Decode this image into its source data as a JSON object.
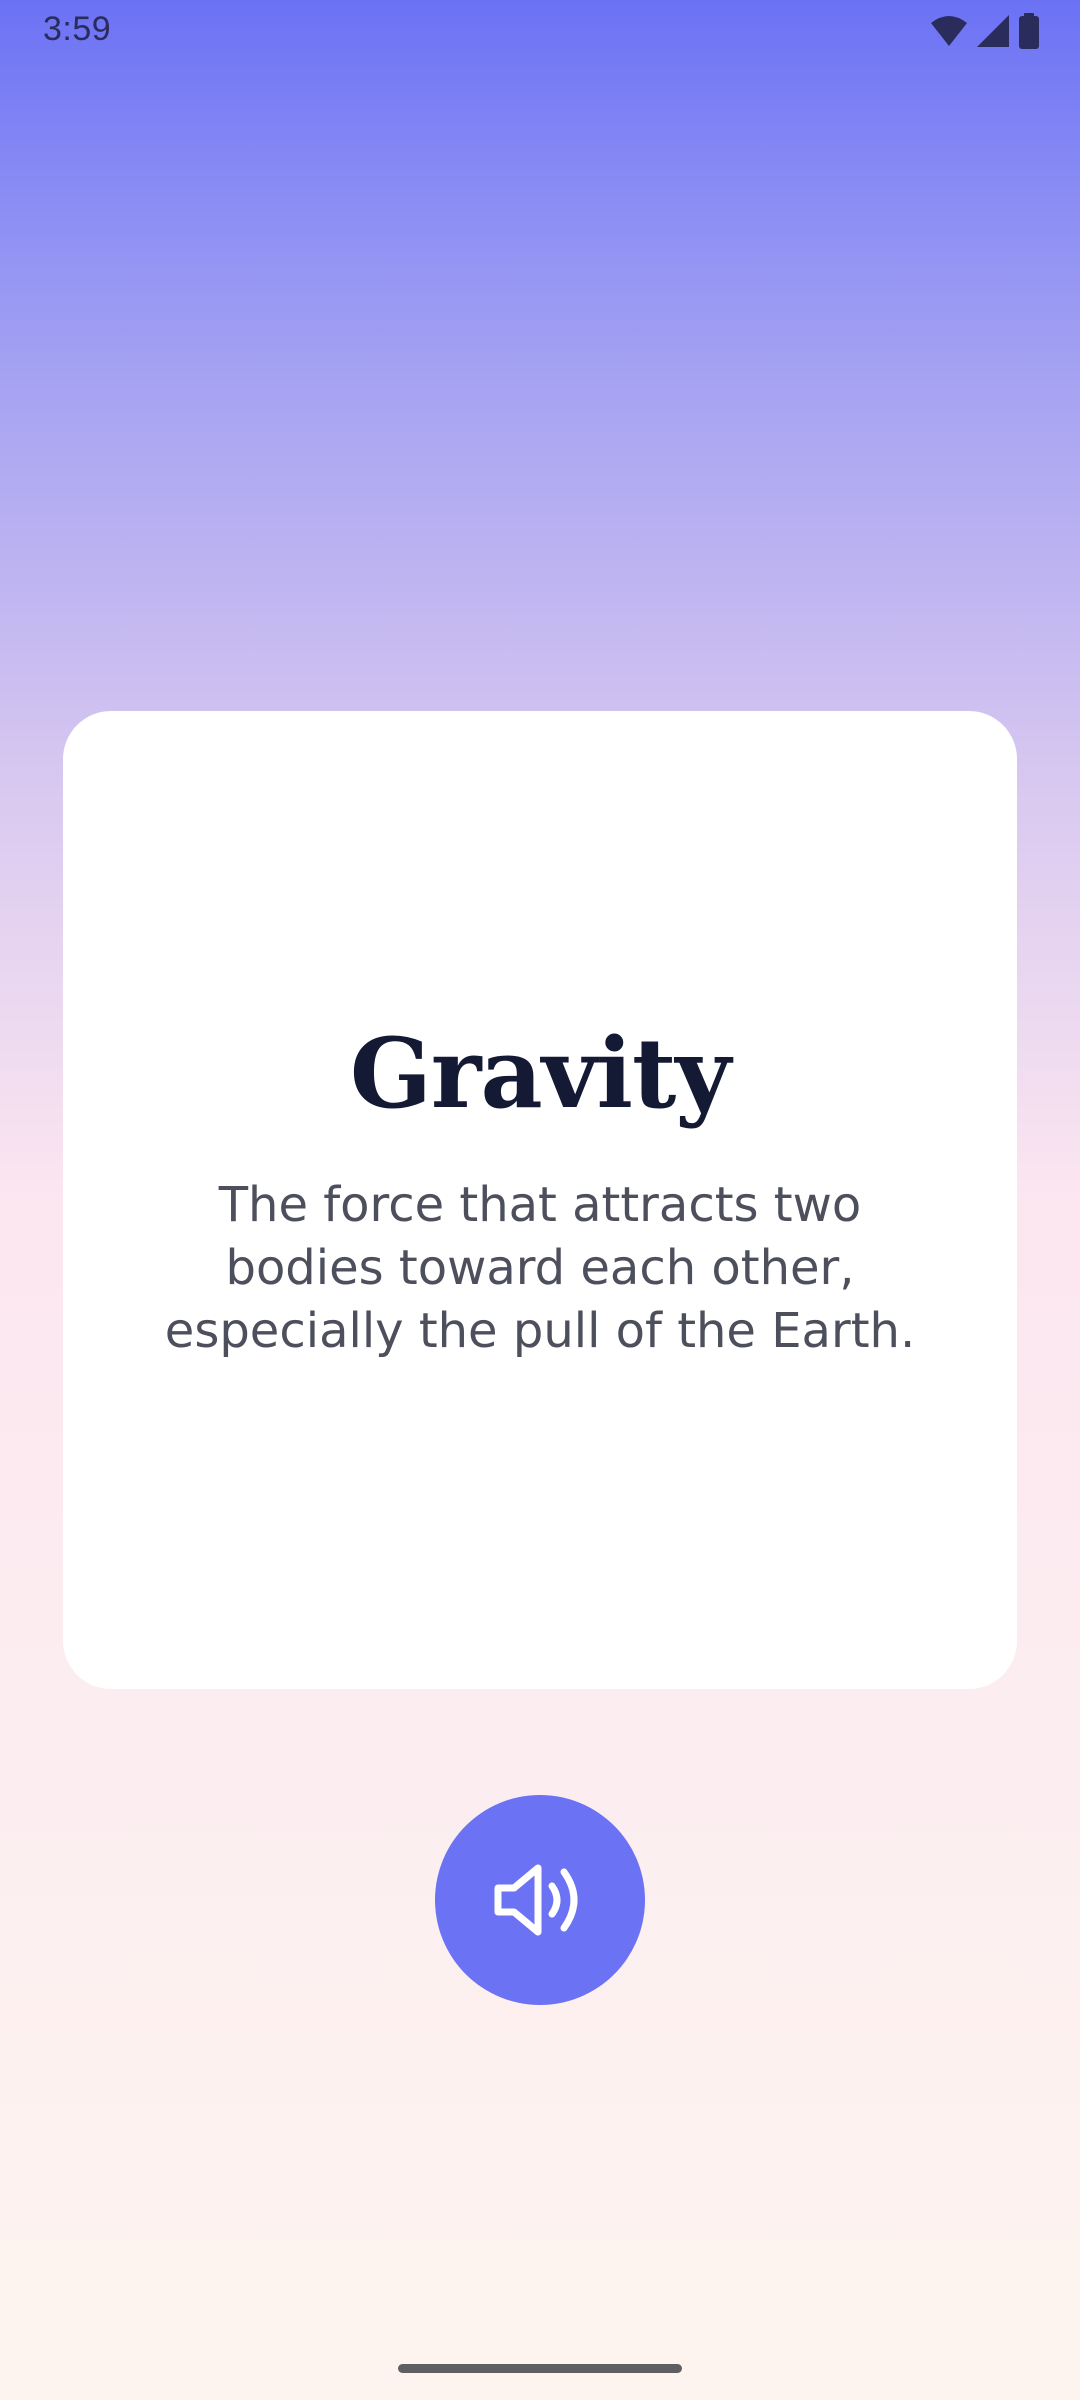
{
  "status_bar": {
    "time": "3:59",
    "icons": [
      "wifi-icon",
      "cellular-signal-icon",
      "battery-icon"
    ]
  },
  "card": {
    "word": "Gravity",
    "definition": "The force that attracts two bodies toward each other, especially the pull of the Earth."
  },
  "actions": {
    "speak_button_icon": "speaker-volume-icon"
  },
  "colors": {
    "gradient_top": "#6b72f4",
    "gradient_bottom": "#fdf4ef",
    "accent": "#6b73f4",
    "card_background": "#ffffff",
    "word_text": "#141a33",
    "definition_text": "#4d4f5c"
  }
}
